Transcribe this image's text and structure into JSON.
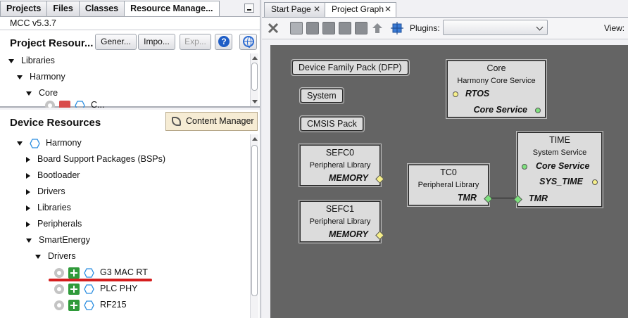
{
  "left_tabs": [
    "Projects",
    "Files",
    "Classes",
    "Resource Manage..."
  ],
  "mcc_version": "MCC v5.3.7",
  "project_resources": {
    "title": "Project Resour...",
    "buttons": {
      "generate": "Gener...",
      "import": "Impo...",
      "export": "Exp..."
    },
    "tree": [
      "Libraries",
      "Harmony",
      "Core",
      "C..."
    ]
  },
  "device_resources": {
    "title": "Device Resources",
    "content_manager": "Content Manager",
    "tree": {
      "harmony": "Harmony",
      "bsp": "Board Support Packages (BSPs)",
      "bootloader": "Bootloader",
      "drivers": "Drivers",
      "libraries": "Libraries",
      "peripherals": "Peripherals",
      "smartenergy": "SmartEnergy",
      "se_drivers": "Drivers",
      "items": [
        "G3 MAC RT",
        "PLC PHY",
        "RF215"
      ]
    }
  },
  "right_tabs": [
    "Start Page",
    "Project Graph"
  ],
  "toolbar": {
    "plugins_label": "Plugins:",
    "plugins_value": "",
    "view_label": "View:"
  },
  "graph": {
    "pills": [
      "Device Family Pack (DFP)",
      "System",
      "CMSIS Pack"
    ],
    "core": {
      "title": "Core",
      "sub": "Harmony Core Service",
      "port1": "RTOS",
      "port2": "Core Service"
    },
    "sefc0": {
      "title": "SEFC0",
      "sub": "Peripheral Library",
      "port": "MEMORY"
    },
    "sefc1": {
      "title": "SEFC1",
      "sub": "Peripheral Library",
      "port": "MEMORY"
    },
    "tc0": {
      "title": "TC0",
      "sub": "Peripheral Library",
      "port": "TMR"
    },
    "time": {
      "title": "TIME",
      "sub": "System Service",
      "port1": "Core Service",
      "port2": "SYS_TIME",
      "port3": "TMR"
    }
  },
  "colors": {
    "graph_bg": "#646464",
    "node_bg": "#dcdcdc",
    "port_yellow": "#f6ef8a",
    "port_green": "#7ee07e",
    "highlight_red": "#d51e1e",
    "add_green": "#2f9a3a"
  }
}
